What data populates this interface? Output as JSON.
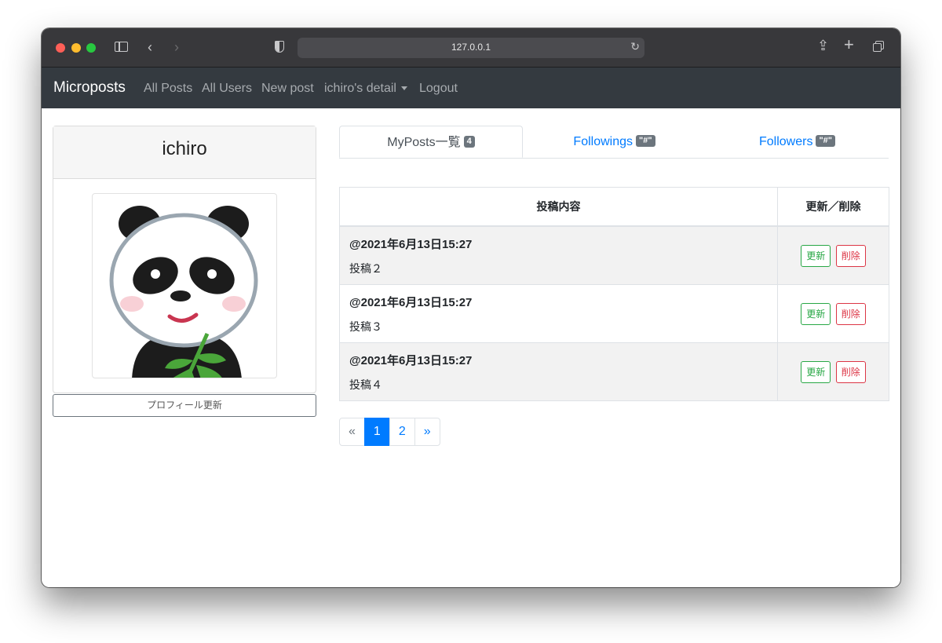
{
  "browser": {
    "url": "127.0.0.1"
  },
  "navbar": {
    "brand": "Microposts",
    "links": [
      "All Posts",
      "All Users",
      "New post",
      "ichiro's detail",
      "Logout"
    ]
  },
  "profile": {
    "username": "ichiro",
    "update_button": "プロフィール更新"
  },
  "tabs": [
    {
      "label": "MyPosts一覧",
      "badge": "4"
    },
    {
      "label": "Followings",
      "badge": "\"#\""
    },
    {
      "label": "Followers",
      "badge": "\"#\""
    }
  ],
  "table": {
    "headers": [
      "投稿内容",
      "更新／削除"
    ],
    "rows": [
      {
        "date": "@2021年6月13日15:27",
        "content": "投稿２",
        "update": "更新",
        "delete": "削除"
      },
      {
        "date": "@2021年6月13日15:27",
        "content": "投稿３",
        "update": "更新",
        "delete": "削除"
      },
      {
        "date": "@2021年6月13日15:27",
        "content": "投稿４",
        "update": "更新",
        "delete": "削除"
      }
    ]
  },
  "pagination": {
    "prev": "«",
    "pages": [
      "1",
      "2"
    ],
    "next": "»",
    "current": "1"
  }
}
